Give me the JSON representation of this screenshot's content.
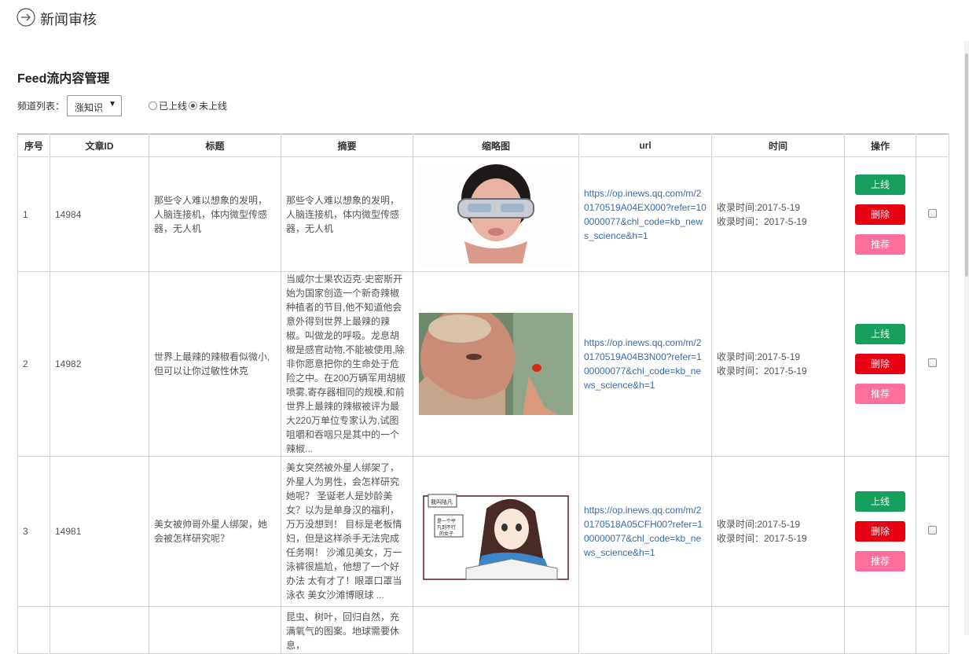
{
  "header": {
    "title": "新闻审核",
    "back_icon": "arrow-circle-right-icon"
  },
  "section": {
    "title": "Feed流内容管理"
  },
  "filter": {
    "channel_label": "频道列表：",
    "channel_value": "涨知识",
    "radio_online": "已上线",
    "radio_offline": "未上线",
    "selected": "未上线"
  },
  "table": {
    "headers": [
      "序号",
      "文章ID",
      "标题",
      "摘要",
      "缩略图",
      "url",
      "时间",
      "操作",
      ""
    ],
    "rows": [
      {
        "index": "1",
        "id": "14984",
        "title": "那些令人难以想象的发明，人脑连接机，体内微型传感器，无人机",
        "summary": "那些令人难以想象的发明，人脑连接机，体内微型传感器，无人机",
        "url": "https://op.inews.qq.com/m/20170519A04EX000?refer=100000077&chl_code=kb_news_science&h=1",
        "time1": "收录时间:2017-5-19",
        "time2": "收录时间：2017-5-19",
        "thumb_icon": "woman-vr-headset-image"
      },
      {
        "index": "2",
        "id": "14982",
        "title": "世界上最辣的辣椒看似微小,但可以让你过敏性休克",
        "summary": "当威尔士果农迈克·史密斯开始为国家创造一个新奇辣椒种植者的节目,他不知道他会意外得到世界上最辣的辣椒。叫做龙的呼吸。龙息胡椒是感官动物,不能被使用,除非你愿意把你的生命处于危险之中。在200万辆军用胡椒喷雾,寄存器相同的规模,和前世界上最辣的辣椒被评为最大220万单位专家认为,试图咀嚼和吞咽只是其中的一个辣椒...",
        "url": "https://op.inews.qq.com/m/20170519A04B3N00?refer=100000077&chl_code=kb_news_science&h=1",
        "time1": "收录时间:2017-5-19",
        "time2": "收录时间：2017-5-19",
        "thumb_icon": "man-with-chili-image"
      },
      {
        "index": "3",
        "id": "14981",
        "title": "美女被帅哥外星人绑架，她会被怎样研究呢？",
        "summary": "美女突然被外星人绑架了，外星人为男性，会怎样研究她呢？ 圣诞老人是妙龄美女？以为是单身汉的福利，万万没想到！ 目标是老板情妇，但是这样杀手无法完成任务啊！ 沙滩见美女，万一泳裤很尴尬，他想了一个好办法 太有才了！眼罩口罩当泳衣 美女沙滩博眼球 ...",
        "url": "https://op.inews.qq.com/m/20170518A05CFH00?refer=100000077&chl_code=kb_news_science&h=1",
        "time1": "收录时间:2017-5-19",
        "time2": "收录时间：2017-5-19",
        "thumb_icon": "manga-girl-image",
        "thumb_text1": "我叫陆凡",
        "thumb_text2": "是一个平凡到不行的女子"
      },
      {
        "index": "",
        "id": "",
        "title": "",
        "summary": "昆虫、树叶，回归自然，充满氧气的图案。地球需要休息，",
        "url": "",
        "time1": "",
        "time2": "",
        "thumb_icon": ""
      }
    ]
  },
  "buttons": {
    "online": "上线",
    "delete": "删除",
    "recommend": "推荐"
  },
  "colors": {
    "online": "#17a05d",
    "delete": "#e60012",
    "recommend": "#ff6f9b",
    "link": "#3b6ca8"
  }
}
